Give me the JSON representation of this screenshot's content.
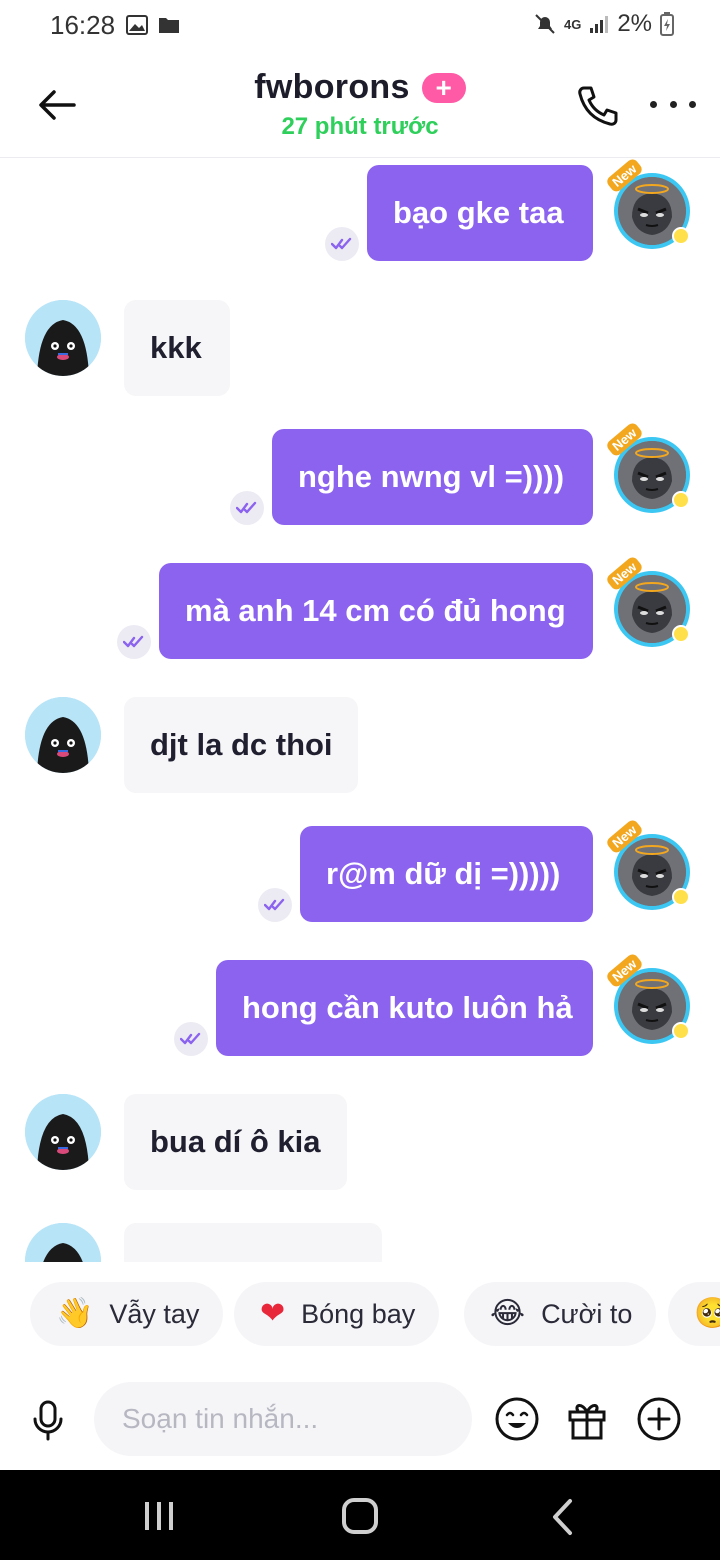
{
  "status_bar": {
    "time": "16:28",
    "network": "4G",
    "battery": "2%",
    "icons": [
      "image-icon",
      "folder-icon",
      "mute-icon",
      "signal-icon",
      "battery-charging-icon"
    ]
  },
  "header": {
    "title": "fwborons",
    "badge": "+",
    "subtitle": "27 phút trước",
    "back_icon": "arrow-left-icon",
    "call_icon": "phone-icon",
    "more_icon": "more-dots-icon"
  },
  "colors": {
    "outgoing_bubble": "#8b63ef",
    "incoming_bubble": "#f6f6f8",
    "online_status": "#2ecf5a",
    "badge": "#ff5aa5"
  },
  "messages": [
    {
      "direction": "out",
      "text": "bạo gke taa",
      "read": true
    },
    {
      "direction": "in",
      "text": "kkk"
    },
    {
      "direction": "out",
      "text": "nghe nwng vl =))))",
      "read": true
    },
    {
      "direction": "out",
      "text": "mà anh 14 cm có đủ hong",
      "read": true
    },
    {
      "direction": "in",
      "text": "djt la dc thoi"
    },
    {
      "direction": "out",
      "text": "r@m dữ dị =)))))",
      "read": true
    },
    {
      "direction": "out",
      "text": "hong cần kuto luôn hả",
      "read": true
    },
    {
      "direction": "in",
      "text": "bua dí ô kia"
    }
  ],
  "avatar_labels": {
    "me_badge": "New"
  },
  "quick_reactions": [
    {
      "emoji": "👋",
      "label": "Vẫy tay"
    },
    {
      "emoji": "❤",
      "label": "Bóng bay"
    },
    {
      "emoji": "😂",
      "label": "Cười to"
    },
    {
      "emoji": "🥺",
      "label": ""
    }
  ],
  "composer": {
    "placeholder": "Soạn tin nhắn...",
    "icons": [
      "microphone-icon",
      "emoji-icon",
      "gift-icon",
      "add-circle-icon"
    ]
  }
}
